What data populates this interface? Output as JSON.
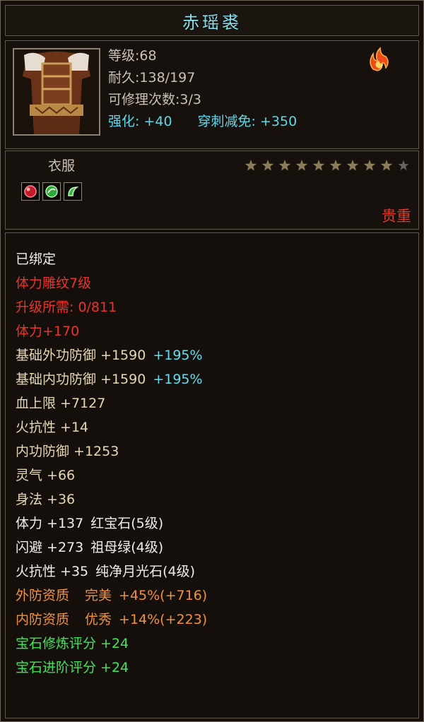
{
  "item": {
    "name": "赤瑶裘",
    "level_label": "等级:68",
    "durability_label": "耐久:138/197",
    "repair_label": "可修理次数:3/3",
    "enhance_label": "强化: +40",
    "pierce_label": "穿刺减免: +350",
    "category": "衣服",
    "stars": {
      "filled": 9,
      "total": 10
    },
    "rarity": "贵重",
    "gems": [
      "ruby-gem-icon",
      "emerald-gem-icon",
      "moonstone-gem-icon"
    ]
  },
  "attributes": {
    "bound": "已绑定",
    "carve": "体力雕纹7级",
    "upgrade": "升级所需: 0/811",
    "stamina_bonus": "体力+170",
    "ext_def_base": "基础外功防御 +1590",
    "ext_def_pct": "+195%",
    "int_def_base": "基础内功防御 +1590",
    "int_def_pct": "+195%",
    "hp": "血上限 +7127",
    "fire_res": "火抗性 +14",
    "int_def": "内功防御 +1253",
    "spirit": "灵气 +66",
    "agility": "身法 +36",
    "gem1_stat": "体力 +137",
    "gem1_name": "红宝石(5级)",
    "gem2_stat": "闪避 +273",
    "gem2_name": "祖母绿(4级)",
    "gem3_stat": "火抗性 +35",
    "gem3_name": "纯净月光石(4级)",
    "ext_quality_label": "外防资质",
    "ext_quality_grade": "完美",
    "ext_quality_value": "+45%(+716)",
    "int_quality_label": "内防资质",
    "int_quality_grade": "优秀",
    "int_quality_value": "+14%(+223)",
    "gem_refine": "宝石修炼评分 +24",
    "gem_advance": "宝石进阶评分 +24"
  },
  "colors": {
    "name": "#86e2f0",
    "rarity": "#e23a2a",
    "red_text": "#e8352b",
    "cyan_text": "#62dff0",
    "orange_text": "#f0923a",
    "green_text": "#41e45a",
    "tan_text": "#e6d7b4"
  }
}
